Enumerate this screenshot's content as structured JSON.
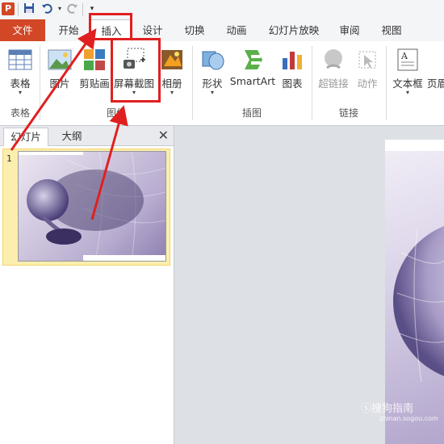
{
  "app": {
    "icon_letter": "P"
  },
  "qat": {
    "items": [
      "save-icon",
      "undo-icon",
      "redo-icon",
      "customize-icon"
    ]
  },
  "tabs": [
    "文件",
    "开始",
    "插入",
    "设计",
    "切换",
    "动画",
    "幻灯片放映",
    "审阅",
    "视图"
  ],
  "active_tab": "插入",
  "ribbon": {
    "buttons": {
      "table": "表格",
      "picture": "图片",
      "clipart": "剪贴画",
      "screenshot": "屏幕截图",
      "album": "相册",
      "shapes": "形状",
      "smartart": "SmartArt",
      "chart": "图表",
      "hyperlink": "超链接",
      "action": "动作",
      "textbox": "文本框",
      "header": "页眉"
    },
    "groups": {
      "tables": "表格",
      "images": "图像",
      "illustrations": "插图",
      "links": "链接"
    }
  },
  "pane": {
    "tabs": [
      "幻灯片",
      "大纲"
    ],
    "close": "✕",
    "slides": [
      {
        "number": "1"
      }
    ]
  },
  "watermark": {
    "text": "ⓢ搜狗指南",
    "url": "zhinan.sogou.com"
  },
  "colors": {
    "file_tab": "#d24726",
    "highlight": "#e02020",
    "workspace": "#dde0e5"
  }
}
